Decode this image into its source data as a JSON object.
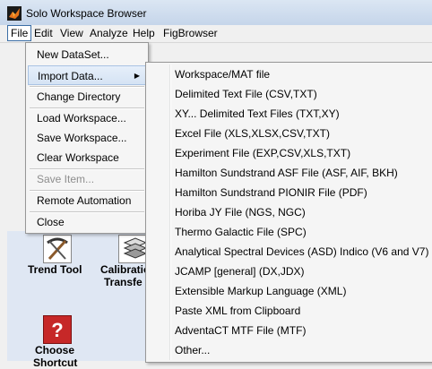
{
  "window": {
    "title": "Solo Workspace Browser"
  },
  "menubar": {
    "items": [
      "File",
      "Edit",
      "View",
      "Analyze",
      "Help",
      "FigBrowser"
    ]
  },
  "file_menu": {
    "items": [
      "New DataSet...",
      "Import Data...",
      "Change Directory",
      "Load Workspace...",
      "Save Workspace...",
      "Clear Workspace",
      "Save Item...",
      "Remote Automation",
      "Close"
    ]
  },
  "import_submenu": {
    "items": [
      "Workspace/MAT file",
      "Delimited Text File (CSV,TXT)",
      "XY... Delimited Text Files (TXT,XY)",
      "Excel File (XLS,XLSX,CSV,TXT)",
      "Experiment File (EXP,CSV,XLS,TXT)",
      "Hamilton Sundstrand ASF File (ASF, AIF, BKH)",
      "Hamilton Sundstrand PIONIR File (PDF)",
      "Horiba JY File (NGS, NGC)",
      "Thermo Galactic File (SPC)",
      "Analytical Spectral Devices (ASD) Indico (V6 and V7)",
      "JCAMP [general] (DX,JDX)",
      "Extensible Markup Language (XML)",
      "Paste XML from Clipboard",
      "AdventaCT MTF File (MTF)",
      "Other..."
    ]
  },
  "workspace": {
    "shortcuts": [
      "Trend Tool",
      "Calibratio",
      "Transfe",
      "Choose",
      "Shortcut"
    ]
  },
  "colors": {
    "title_gradient_top": "#dbe6f3",
    "menu_highlight": "#d5e3f4",
    "workspace_bg": "#dfe7f3"
  }
}
